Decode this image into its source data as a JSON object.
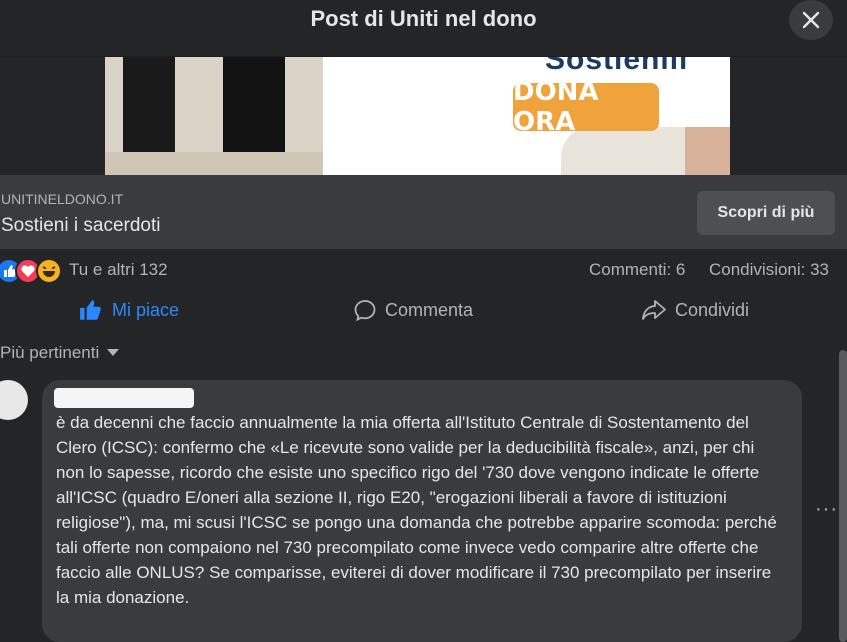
{
  "header": {
    "title": "Post di Uniti nel dono"
  },
  "ad": {
    "headline": "Sostienili",
    "cta_label": "DONA ORA",
    "cta_color": "#f1a33b"
  },
  "link_card": {
    "domain": "UNITINELDONO.IT",
    "title": "Sostieni i sacerdoti",
    "button_label": "Scopri di più"
  },
  "reactions": {
    "summary": "Tu e altri 132",
    "comments": "Commenti: 6",
    "shares": "Condivisioni: 33",
    "icons": [
      "like-icon",
      "love-icon",
      "haha-icon"
    ]
  },
  "actions": {
    "like_label": "Mi piace",
    "comment_label": "Commenta",
    "share_label": "Condividi",
    "like_color": "#2d88ff"
  },
  "sort": {
    "label": "Più pertinenti"
  },
  "comment": {
    "text": "è da decenni che faccio annualmente la mia offerta all'Istituto Centrale di Sostentamento del Clero (ICSC): confermo che «Le ricevute sono valide per la deducibilità fiscale», anzi, per chi non lo sapesse, ricordo che esiste uno specifico rigo del '730 dove vengono indicate le offerte all'ICSC (quadro E/oneri alla sezione II, rigo E20, \"erogazioni liberali a favore di istituzioni religiose\"), ma, mi scusi l'ICSC se pongo una domanda che potrebbe apparire scomoda: perché tali offerte non compaiono nel 730 precompilato come invece vedo comparire altre offerte che faccio alle ONLUS? Se comparisse, eviterei di dover modificare il 730 precompilato per inserire la mia donazione."
  }
}
